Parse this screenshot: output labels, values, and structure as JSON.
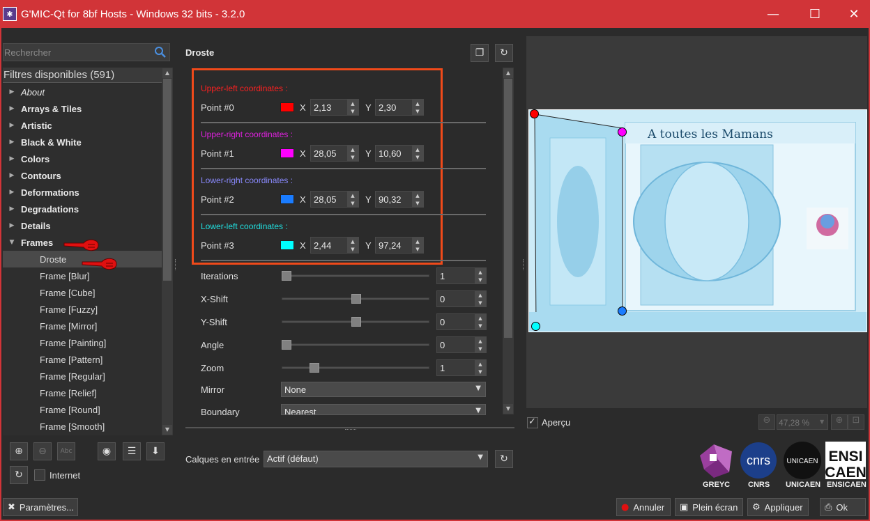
{
  "window": {
    "title": "G'MIC-Qt for 8bf Hosts - Windows 32 bits - 3.2.0",
    "minimize": "—",
    "maximize": "☐",
    "close": "✕"
  },
  "search": {
    "placeholder": "Rechercher"
  },
  "filters": {
    "header": "Filtres disponibles (591)",
    "categories": [
      {
        "label": "About",
        "italic": true
      },
      {
        "label": "Arrays & Tiles"
      },
      {
        "label": "Artistic"
      },
      {
        "label": "Black & White"
      },
      {
        "label": "Colors"
      },
      {
        "label": "Contours"
      },
      {
        "label": "Deformations"
      },
      {
        "label": "Degradations"
      },
      {
        "label": "Details"
      },
      {
        "label": "Frames",
        "expanded": true
      }
    ],
    "children": [
      "Droste",
      "Frame [Blur]",
      "Frame [Cube]",
      "Frame [Fuzzy]",
      "Frame [Mirror]",
      "Frame [Painting]",
      "Frame [Pattern]",
      "Frame [Regular]",
      "Frame [Relief]",
      "Frame [Round]",
      "Frame [Smooth]"
    ],
    "selected": "Droste"
  },
  "internet_label": "Internet",
  "parametres_label": "Paramètres...",
  "filter": {
    "name": "Droste",
    "points": [
      {
        "title": "Upper-left coordinates :",
        "title_color": "#ff2020",
        "label": "Point #0",
        "color": "#ff0000",
        "x": "2,13",
        "y": "2,30"
      },
      {
        "title": "Upper-right coordinates :",
        "title_color": "#e020e0",
        "label": "Point #1",
        "color": "#ff00ff",
        "x": "28,05",
        "y": "10,60"
      },
      {
        "title": "Lower-right coordinates :",
        "title_color": "#8a8aff",
        "label": "Point #2",
        "color": "#1a7cff",
        "x": "28,05",
        "y": "90,32"
      },
      {
        "title": "Lower-left coordinates :",
        "title_color": "#20e0e0",
        "label": "Point #3",
        "color": "#00ffff",
        "x": "2,44",
        "y": "97,24"
      }
    ],
    "x_label": "X",
    "y_label": "Y",
    "sliders": [
      {
        "label": "Iterations",
        "value": "1",
        "fraction": 0.0
      },
      {
        "label": "X-Shift",
        "value": "0",
        "fraction": 0.5
      },
      {
        "label": "Y-Shift",
        "value": "0",
        "fraction": 0.5
      },
      {
        "label": "Angle",
        "value": "0",
        "fraction": 0.0
      },
      {
        "label": "Zoom",
        "value": "1",
        "fraction": 0.2
      }
    ],
    "mirror": {
      "label": "Mirror",
      "value": "None"
    },
    "boundary": {
      "label": "Boundary",
      "value": "Nearest"
    }
  },
  "input_layers": {
    "label": "Calques en entrée",
    "value": "Actif (défaut)"
  },
  "preview": {
    "apercu_label": "Aperçu",
    "apercu_checked": true,
    "zoom": "47,28 %",
    "image_text": "A toutes les Mamans"
  },
  "logos": [
    "GREYC",
    "CNRS",
    "UNICAEN",
    "ENSICAEN"
  ],
  "buttons": {
    "cancel": "Annuler",
    "fullscreen": "Plein écran",
    "apply": "Appliquer",
    "ok": "Ok"
  }
}
